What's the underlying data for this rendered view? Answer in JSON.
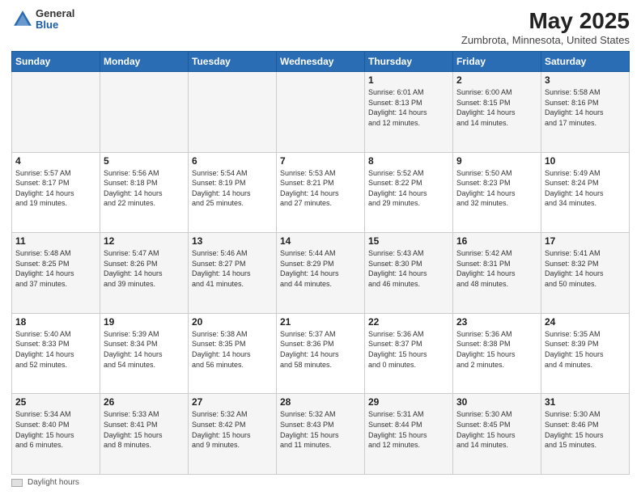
{
  "header": {
    "logo_general": "General",
    "logo_blue": "Blue",
    "title": "May 2025",
    "subtitle": "Zumbrota, Minnesota, United States"
  },
  "days_of_week": [
    "Sunday",
    "Monday",
    "Tuesday",
    "Wednesday",
    "Thursday",
    "Friday",
    "Saturday"
  ],
  "weeks": [
    [
      {
        "day": "",
        "info": ""
      },
      {
        "day": "",
        "info": ""
      },
      {
        "day": "",
        "info": ""
      },
      {
        "day": "",
        "info": ""
      },
      {
        "day": "1",
        "info": "Sunrise: 6:01 AM\nSunset: 8:13 PM\nDaylight: 14 hours\nand 12 minutes."
      },
      {
        "day": "2",
        "info": "Sunrise: 6:00 AM\nSunset: 8:15 PM\nDaylight: 14 hours\nand 14 minutes."
      },
      {
        "day": "3",
        "info": "Sunrise: 5:58 AM\nSunset: 8:16 PM\nDaylight: 14 hours\nand 17 minutes."
      }
    ],
    [
      {
        "day": "4",
        "info": "Sunrise: 5:57 AM\nSunset: 8:17 PM\nDaylight: 14 hours\nand 19 minutes."
      },
      {
        "day": "5",
        "info": "Sunrise: 5:56 AM\nSunset: 8:18 PM\nDaylight: 14 hours\nand 22 minutes."
      },
      {
        "day": "6",
        "info": "Sunrise: 5:54 AM\nSunset: 8:19 PM\nDaylight: 14 hours\nand 25 minutes."
      },
      {
        "day": "7",
        "info": "Sunrise: 5:53 AM\nSunset: 8:21 PM\nDaylight: 14 hours\nand 27 minutes."
      },
      {
        "day": "8",
        "info": "Sunrise: 5:52 AM\nSunset: 8:22 PM\nDaylight: 14 hours\nand 29 minutes."
      },
      {
        "day": "9",
        "info": "Sunrise: 5:50 AM\nSunset: 8:23 PM\nDaylight: 14 hours\nand 32 minutes."
      },
      {
        "day": "10",
        "info": "Sunrise: 5:49 AM\nSunset: 8:24 PM\nDaylight: 14 hours\nand 34 minutes."
      }
    ],
    [
      {
        "day": "11",
        "info": "Sunrise: 5:48 AM\nSunset: 8:25 PM\nDaylight: 14 hours\nand 37 minutes."
      },
      {
        "day": "12",
        "info": "Sunrise: 5:47 AM\nSunset: 8:26 PM\nDaylight: 14 hours\nand 39 minutes."
      },
      {
        "day": "13",
        "info": "Sunrise: 5:46 AM\nSunset: 8:27 PM\nDaylight: 14 hours\nand 41 minutes."
      },
      {
        "day": "14",
        "info": "Sunrise: 5:44 AM\nSunset: 8:29 PM\nDaylight: 14 hours\nand 44 minutes."
      },
      {
        "day": "15",
        "info": "Sunrise: 5:43 AM\nSunset: 8:30 PM\nDaylight: 14 hours\nand 46 minutes."
      },
      {
        "day": "16",
        "info": "Sunrise: 5:42 AM\nSunset: 8:31 PM\nDaylight: 14 hours\nand 48 minutes."
      },
      {
        "day": "17",
        "info": "Sunrise: 5:41 AM\nSunset: 8:32 PM\nDaylight: 14 hours\nand 50 minutes."
      }
    ],
    [
      {
        "day": "18",
        "info": "Sunrise: 5:40 AM\nSunset: 8:33 PM\nDaylight: 14 hours\nand 52 minutes."
      },
      {
        "day": "19",
        "info": "Sunrise: 5:39 AM\nSunset: 8:34 PM\nDaylight: 14 hours\nand 54 minutes."
      },
      {
        "day": "20",
        "info": "Sunrise: 5:38 AM\nSunset: 8:35 PM\nDaylight: 14 hours\nand 56 minutes."
      },
      {
        "day": "21",
        "info": "Sunrise: 5:37 AM\nSunset: 8:36 PM\nDaylight: 14 hours\nand 58 minutes."
      },
      {
        "day": "22",
        "info": "Sunrise: 5:36 AM\nSunset: 8:37 PM\nDaylight: 15 hours\nand 0 minutes."
      },
      {
        "day": "23",
        "info": "Sunrise: 5:36 AM\nSunset: 8:38 PM\nDaylight: 15 hours\nand 2 minutes."
      },
      {
        "day": "24",
        "info": "Sunrise: 5:35 AM\nSunset: 8:39 PM\nDaylight: 15 hours\nand 4 minutes."
      }
    ],
    [
      {
        "day": "25",
        "info": "Sunrise: 5:34 AM\nSunset: 8:40 PM\nDaylight: 15 hours\nand 6 minutes."
      },
      {
        "day": "26",
        "info": "Sunrise: 5:33 AM\nSunset: 8:41 PM\nDaylight: 15 hours\nand 8 minutes."
      },
      {
        "day": "27",
        "info": "Sunrise: 5:32 AM\nSunset: 8:42 PM\nDaylight: 15 hours\nand 9 minutes."
      },
      {
        "day": "28",
        "info": "Sunrise: 5:32 AM\nSunset: 8:43 PM\nDaylight: 15 hours\nand 11 minutes."
      },
      {
        "day": "29",
        "info": "Sunrise: 5:31 AM\nSunset: 8:44 PM\nDaylight: 15 hours\nand 12 minutes."
      },
      {
        "day": "30",
        "info": "Sunrise: 5:30 AM\nSunset: 8:45 PM\nDaylight: 15 hours\nand 14 minutes."
      },
      {
        "day": "31",
        "info": "Sunrise: 5:30 AM\nSunset: 8:46 PM\nDaylight: 15 hours\nand 15 minutes."
      }
    ]
  ],
  "footer": {
    "daylight_label": "Daylight hours"
  }
}
